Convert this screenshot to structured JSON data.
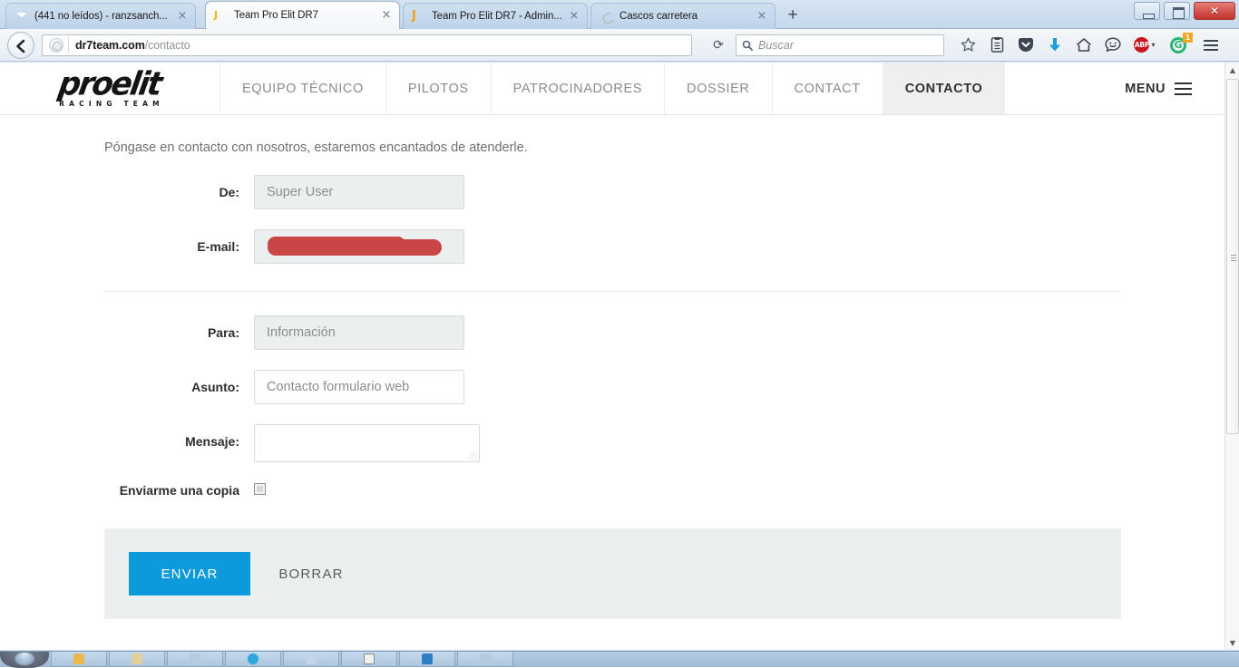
{
  "browser": {
    "tabs": [
      {
        "title": "(441 no leídos) - ranzsanch...",
        "favicon": "mail-icon",
        "active": false
      },
      {
        "title": "Team Pro Elit DR7",
        "favicon": "joomla-dark-icon",
        "active": true
      },
      {
        "title": "Team Pro Elit DR7 - Admin...",
        "favicon": "joomla-light-icon",
        "active": false
      },
      {
        "title": "Cascos carretera",
        "favicon": "generic-site-icon",
        "active": false
      }
    ],
    "new_tab_label": "+",
    "tab_close_label": "×",
    "window_controls": {
      "minimize": "minimize-icon",
      "maximize": "restore-icon",
      "close": "close-icon"
    },
    "toolbar": {
      "back_label": "back-arrow-icon",
      "url_domain": "dr7team.com",
      "url_path": "/contacto",
      "reload_label": "⟳",
      "search_placeholder": "Buscar",
      "icons": [
        "bookmark-star-icon",
        "reading-list-icon",
        "pocket-icon",
        "downloads-icon",
        "home-icon",
        "hello-icon"
      ],
      "adblock_label": "ABP",
      "adblock_caret": "▾",
      "ghostery_label": "G",
      "ghostery_count": "1",
      "menu_label": "hamburger-menu-icon"
    }
  },
  "site": {
    "logo": {
      "word": "proelit",
      "subtitle": "RACING TEAM"
    },
    "nav": [
      {
        "label": "EQUIPO TÉCNICO",
        "active": false
      },
      {
        "label": "PILOTOS",
        "active": false
      },
      {
        "label": "PATROCINADORES",
        "active": false
      },
      {
        "label": "DOSSIER",
        "active": false
      },
      {
        "label": "CONTACT",
        "active": false
      },
      {
        "label": "CONTACTO",
        "active": true
      }
    ],
    "menu_toggle_label": "MENU"
  },
  "form": {
    "intro": "Póngase en contacto con nosotros, estaremos encantados de atenderle.",
    "fields": {
      "from": {
        "label": "De:",
        "value": "Super User",
        "readonly": true
      },
      "email": {
        "label": "E-mail:",
        "value": "",
        "redacted": true,
        "readonly": true
      },
      "to": {
        "label": "Para:",
        "value": "Información",
        "readonly": true
      },
      "subject": {
        "label": "Asunto:",
        "value": "Contacto formulario web",
        "readonly": false
      },
      "message": {
        "label": "Mensaje:",
        "value": "",
        "readonly": false
      }
    },
    "copy_checkbox_label": "Enviarme una copia",
    "send_label": "ENVIAR",
    "clear_label": "BORRAR"
  },
  "colors": {
    "accent_blue": "#0c9add",
    "redaction_red": "#c94646",
    "panel_gray": "#eceff0",
    "active_nav_gray": "#efefef"
  },
  "scrollbar": {
    "up_arrow": "▲",
    "down_arrow": "▼"
  }
}
